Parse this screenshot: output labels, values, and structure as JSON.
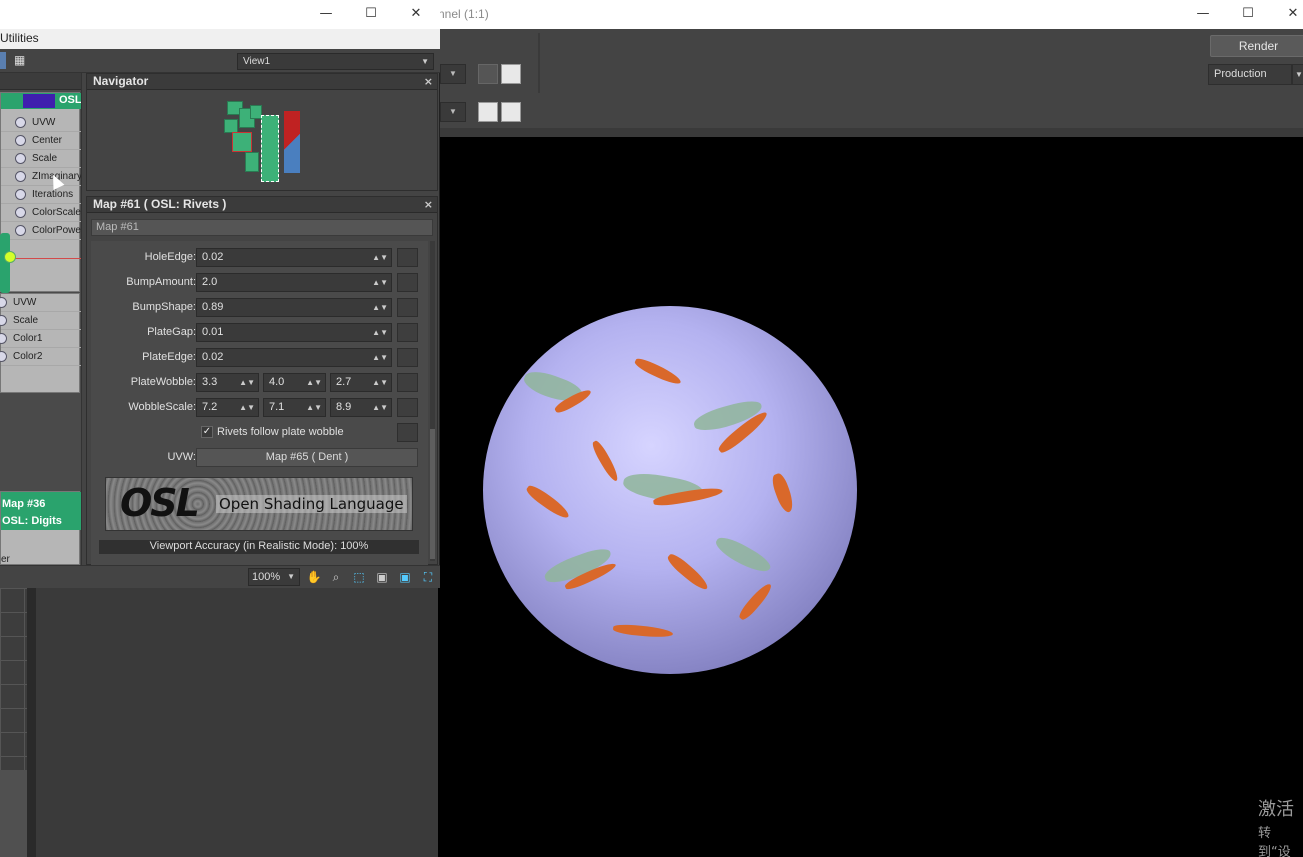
{
  "render_window": {
    "title_fragment": "nnel (1:1)",
    "render_label": "Render",
    "preset_value": "Production",
    "watermark_line1": "激活",
    "watermark_line2": "转到“设"
  },
  "slate": {
    "menu_fragment": "Utilities",
    "view_select": "View1",
    "nodes": {
      "node1_title_fragment": "OSL",
      "node1_ports": [
        "UVW",
        "Center",
        "Scale",
        "ZImaginary",
        "Iterations",
        "ColorScale",
        "ColorPower"
      ],
      "node2_ports": [
        "UVW",
        "Scale",
        "Color1",
        "Color2"
      ],
      "node3_line1": "Map #36",
      "node3_line2": "OSL: Digits",
      "node3_bottom": "er"
    },
    "navigator": {
      "title": "Navigator"
    },
    "params": {
      "title": "Map #61  ( OSL: Rivets )",
      "map_name": "Map #61",
      "rows": [
        {
          "label": "HoleEdge:",
          "value": "0.02"
        },
        {
          "label": "BumpAmount:",
          "value": "2.0"
        },
        {
          "label": "BumpShape:",
          "value": "0.89"
        },
        {
          "label": "PlateGap:",
          "value": "0.01"
        },
        {
          "label": "PlateEdge:",
          "value": "0.02"
        }
      ],
      "plate_wobble": {
        "label": "PlateWobble:",
        "x": "3.3",
        "y": "4.0",
        "z": "2.7"
      },
      "wobble_scale": {
        "label": "WobbleScale:",
        "x": "7.2",
        "y": "7.1",
        "z": "8.9"
      },
      "checkbox_label": "Rivets follow plate wobble",
      "checkbox_checked": true,
      "uvw_label": "UVW:",
      "uvw_button": "Map #65  ( Dent )",
      "logo_mark": "OSL",
      "logo_text": "Open Shading Language",
      "accuracy": "Viewport Accuracy (in Realistic Mode): 100%"
    },
    "status": {
      "zoom": "100%"
    }
  },
  "colors": {
    "node_green": "#2aa36d",
    "rivet_orange": "#d9682a",
    "sphere_lavender": "#b4b2f0"
  }
}
